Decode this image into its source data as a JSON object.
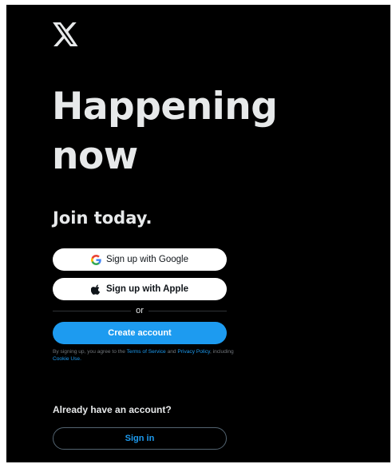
{
  "brand": {
    "logo_icon": "x-logo-icon",
    "text_color": "#e7e9ea",
    "background": "#000000"
  },
  "hero": {
    "line1": "Happening",
    "line2": "now"
  },
  "join": {
    "title": "Join today."
  },
  "signup": {
    "google_label": "Sign up with Google",
    "google_icon": "google-g-icon",
    "apple_label": "Sign up with Apple",
    "apple_icon": "apple-icon",
    "divider_text": "or",
    "create_label": "Create account",
    "accent_color": "#1d9bf0"
  },
  "terms": {
    "part1": "By signing up, you agree to the ",
    "tos_link": "Terms of Service",
    "part2": " and ",
    "privacy_link": "Privacy Policy",
    "part3": ", including ",
    "cookie_link": "Cookie Use.",
    "muted_color": "#71767b"
  },
  "signin": {
    "prompt": "Already have an account?",
    "button_label": "Sign in"
  }
}
